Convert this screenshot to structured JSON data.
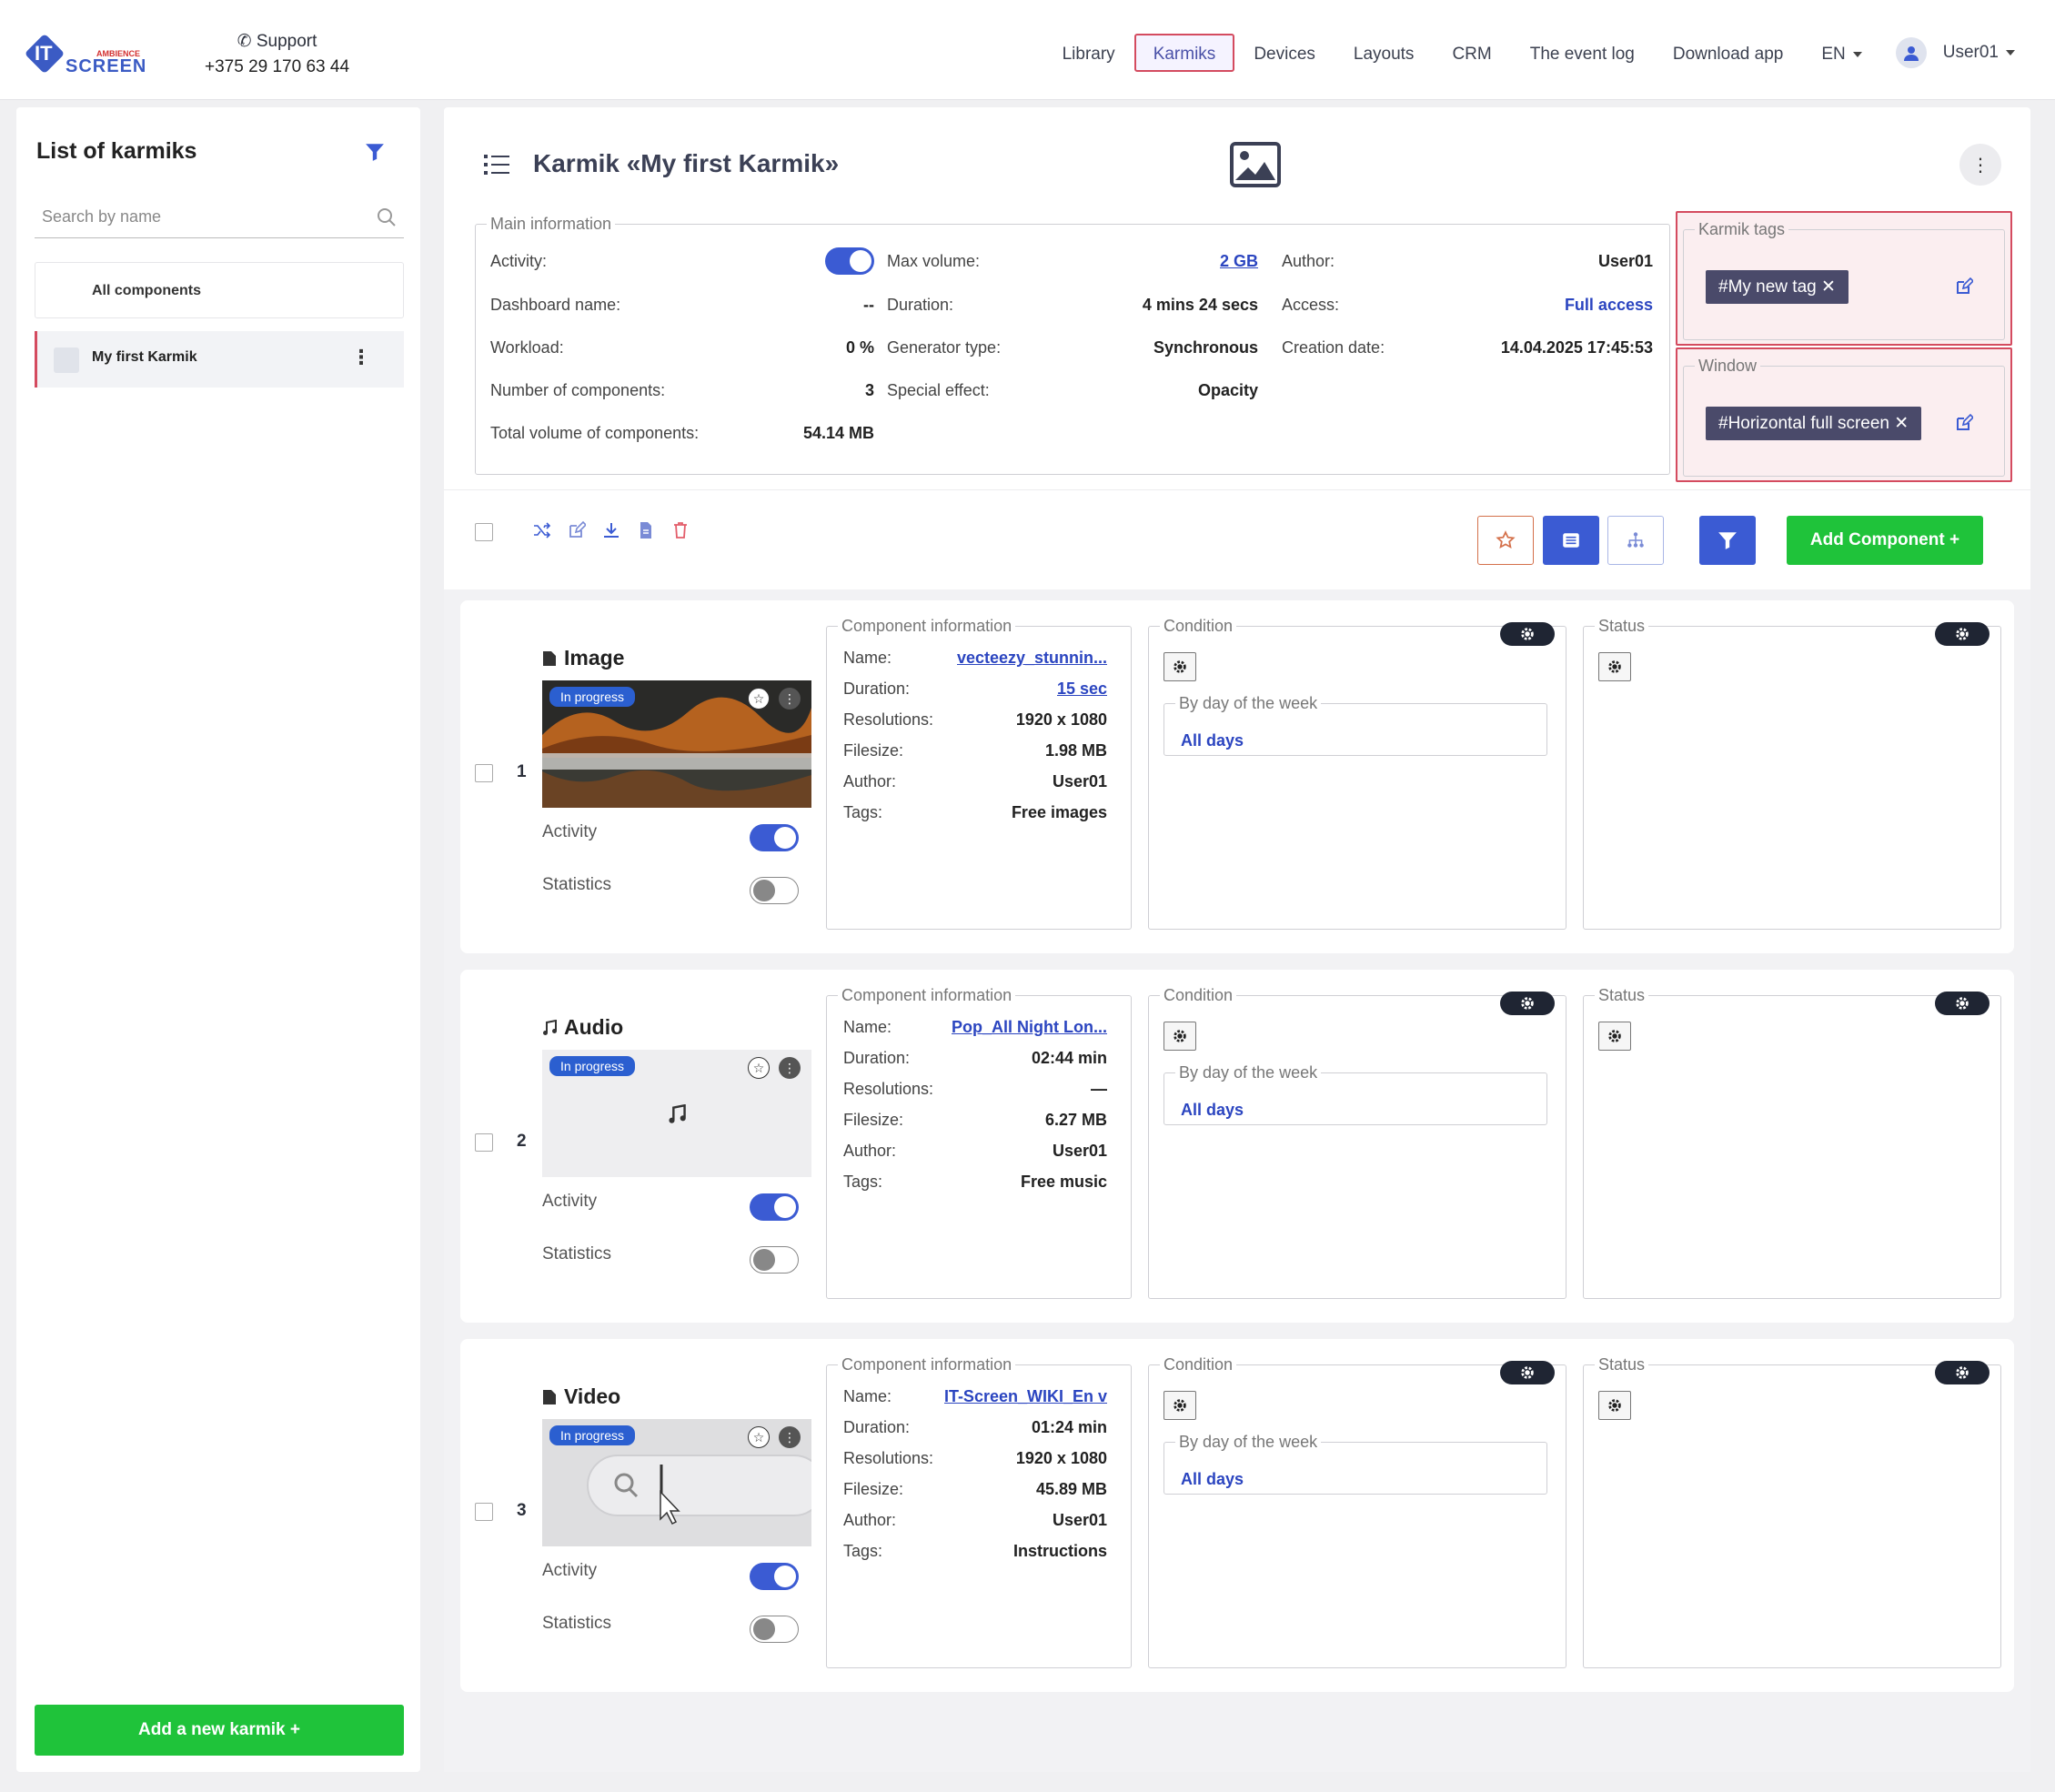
{
  "logo": {
    "it": "IT",
    "ambience": "AMBIENCE",
    "screen": "SCREEN"
  },
  "support": {
    "label": "Support",
    "phone": "+375 29 170 63 44"
  },
  "nav": {
    "items": [
      "Library",
      "Karmiks",
      "Devices",
      "Layouts",
      "CRM",
      "The event log",
      "Download app"
    ],
    "active": "Karmiks",
    "lang": "EN",
    "user": "User01"
  },
  "sidebar": {
    "title": "List of karmiks",
    "search_placeholder": "Search by name",
    "all_components": "All components",
    "items": [
      {
        "label": "My first Karmik"
      }
    ],
    "add_button": "Add a new karmik +"
  },
  "header": {
    "title": "Karmik «My first Karmik»"
  },
  "main_info": {
    "legend": "Main information",
    "activity_label": "Activity:",
    "activity_on": true,
    "dashboard_label": "Dashboard name:",
    "dashboard_value": "--",
    "workload_label": "Workload:",
    "workload_value": "0 %",
    "num_components_label": "Number of components:",
    "num_components_value": "3",
    "total_volume_label": "Total volume of components:",
    "total_volume_value": "54.14 MB",
    "max_volume_label": "Max volume:",
    "max_volume_value": "2 GB",
    "duration_label": "Duration:",
    "duration_value": "4 mins 24 secs",
    "generator_label": "Generator type:",
    "generator_value": "Synchronous",
    "special_label": "Special effect:",
    "special_value": "Opacity",
    "author_label": "Author:",
    "author_value": "User01",
    "access_label": "Access:",
    "access_value": "Full access",
    "creation_label": "Creation date:",
    "creation_value": "14.04.2025 17:45:53"
  },
  "karmik_tags": {
    "legend": "Karmik tags",
    "tag": "#My new tag ✕"
  },
  "window": {
    "legend": "Window",
    "tag": "#Horizontal full screen ✕"
  },
  "toolbar": {
    "add_component": "Add Component  +"
  },
  "labels": {
    "component_information": "Component information",
    "condition": "Condition",
    "status": "Status",
    "by_day": "By day of the week",
    "all_days": "All days",
    "activity": "Activity",
    "statistics": "Statistics",
    "in_progress": "In progress",
    "name": "Name:",
    "duration": "Duration:",
    "resolutions": "Resolutions:",
    "filesize": "Filesize:",
    "author": "Author:",
    "tags": "Tags:"
  },
  "components": [
    {
      "num": "1",
      "type": "Image",
      "name": "vecteezy_stunnin...",
      "duration": "15 sec",
      "resolution": "1920 x 1080",
      "filesize": "1.98 MB",
      "author": "User01",
      "tags": "Free images",
      "activity": true,
      "statistics": false
    },
    {
      "num": "2",
      "type": "Audio",
      "name": "Pop_All Night Lon...",
      "duration": "02:44 min",
      "resolution": "—",
      "filesize": "6.27 MB",
      "author": "User01",
      "tags": "Free music",
      "activity": true,
      "statistics": false
    },
    {
      "num": "3",
      "type": "Video",
      "name": "IT-Screen_WIKI_En v",
      "duration": "01:24 min",
      "resolution": "1920 x 1080",
      "filesize": "45.89 MB",
      "author": "User01",
      "tags": "Instructions",
      "activity": true,
      "statistics": false
    }
  ],
  "colors": {
    "accent": "#3b5bd3",
    "green": "#1fc33a",
    "highlight": "#d44b5f",
    "link": "#2b45c0"
  }
}
